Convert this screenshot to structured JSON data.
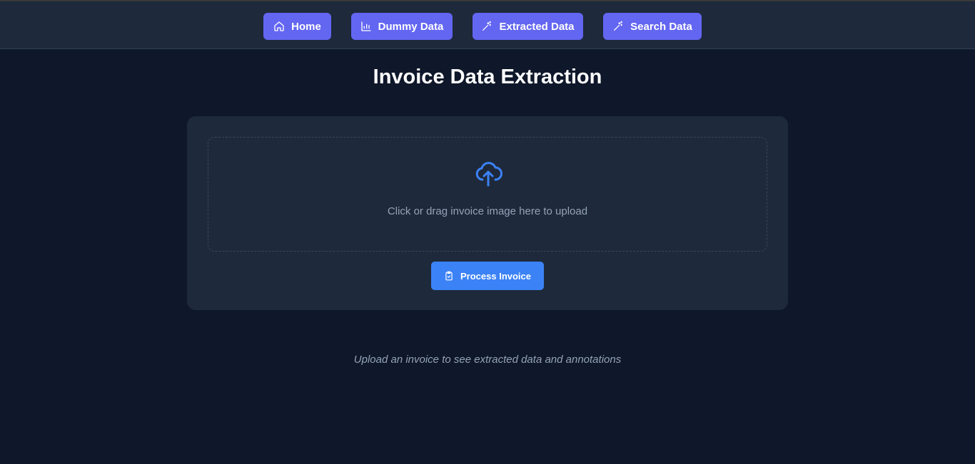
{
  "nav": {
    "items": [
      {
        "label": "Home",
        "icon": "home-icon"
      },
      {
        "label": "Dummy Data",
        "icon": "bar-chart-icon"
      },
      {
        "label": "Extracted Data",
        "icon": "magic-wand-icon"
      },
      {
        "label": "Search Data",
        "icon": "magic-wand-icon"
      }
    ]
  },
  "main": {
    "title": "Invoice Data Extraction",
    "upload": {
      "icon": "cloud-upload-icon",
      "prompt": "Click or drag invoice image here to upload"
    },
    "process_button": {
      "label": "Process Invoice",
      "icon": "clipboard-check-icon"
    },
    "hint": "Upload an invoice to see extracted data and annotations"
  },
  "colors": {
    "background": "#0f172a",
    "surface": "#1e293b",
    "nav_accent": "#6366f1",
    "primary": "#3b82f6",
    "muted_text": "#94a3b8"
  }
}
